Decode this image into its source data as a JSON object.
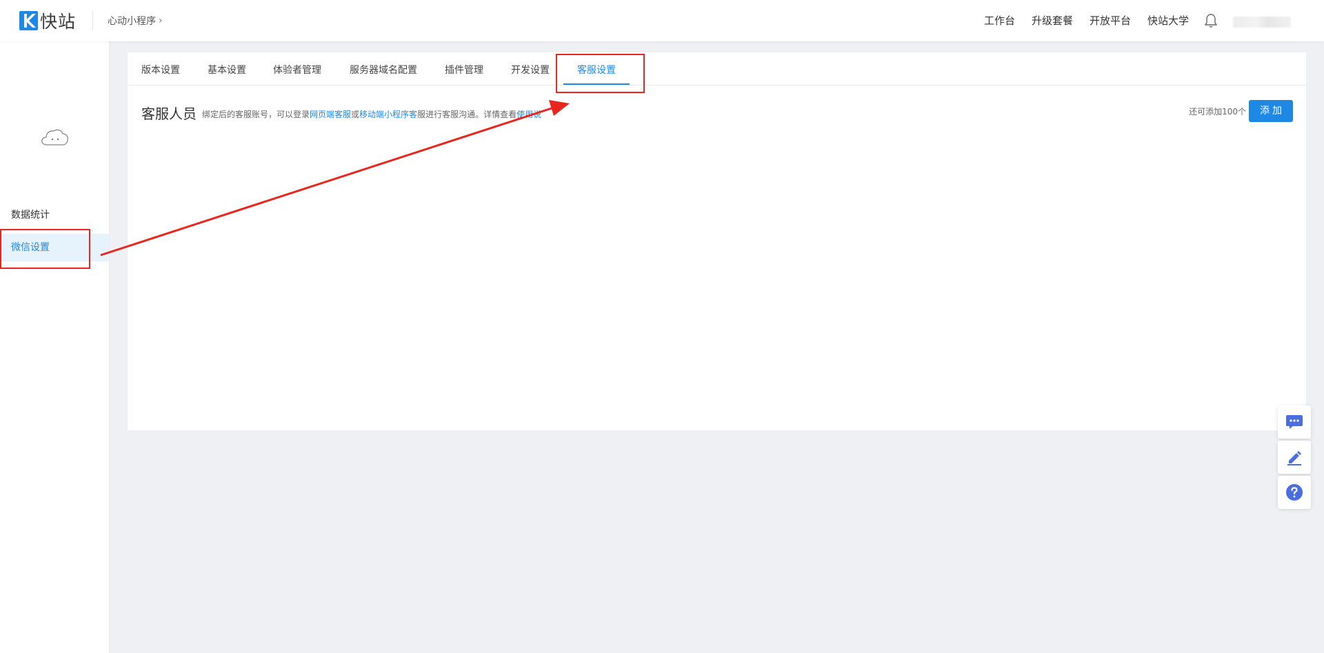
{
  "header": {
    "logo_text": "快站",
    "breadcrumb": "心动小程序",
    "breadcrumb_chevron": "›",
    "nav": [
      "工作台",
      "升级套餐",
      "开放平台",
      "快站大学"
    ]
  },
  "sidebar": {
    "items": [
      {
        "label": "数据统计"
      },
      {
        "label": "微信设置"
      }
    ]
  },
  "tabs": [
    "版本设置",
    "基本设置",
    "体验者管理",
    "服务器域名配置",
    "插件管理",
    "开发设置",
    "客服设置"
  ],
  "active_tab": "客服设置",
  "section": {
    "title": "客服人员",
    "desc_pre": "绑定后的客服账号，可以登录",
    "link1": "网页端客服",
    "desc_mid": "或",
    "link2": "移动端小程序客",
    "desc_post": "服进行客服沟通。详情查看",
    "link3": "使用说",
    "remaining": "还可添加100个",
    "add_button": "添加"
  },
  "colors": {
    "accent": "#1e88e5",
    "annotation": "#e8261e",
    "float_icon": "#4a6ee0"
  },
  "icons": [
    "logo-k-icon",
    "bell-icon",
    "cloud-icon",
    "chat-icon",
    "edit-icon",
    "help-icon"
  ]
}
